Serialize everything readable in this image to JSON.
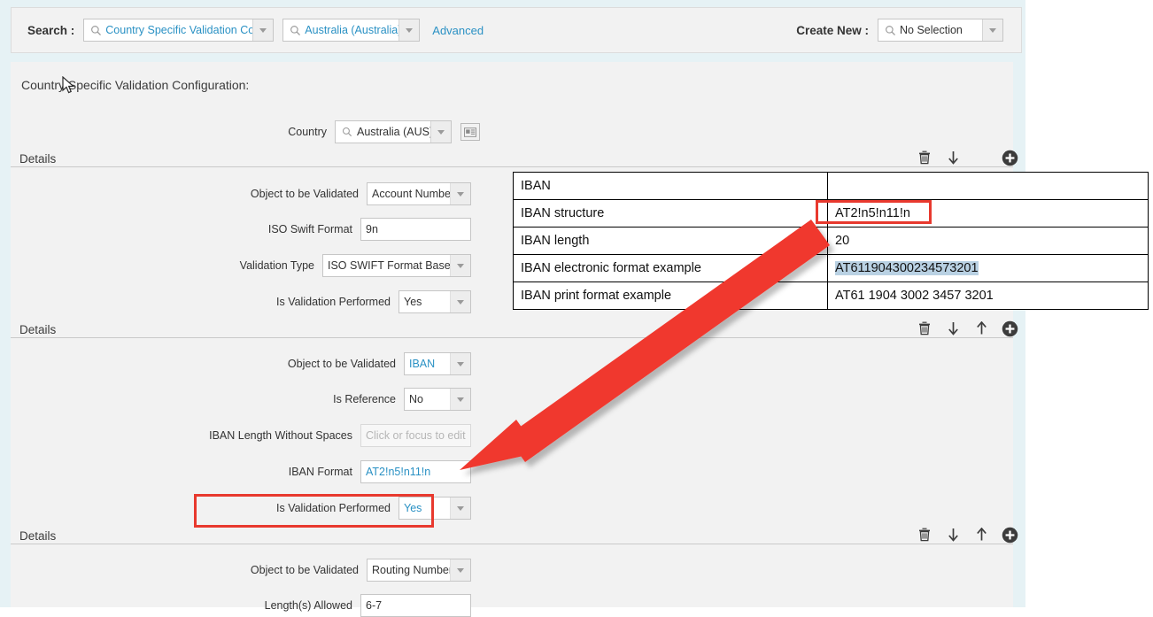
{
  "search_bar": {
    "search_label": "Search :",
    "object_lov": {
      "value": "Country Specific Validation Co...",
      "icon": "search-icon"
    },
    "country_lov": {
      "value": "Australia (Australia)",
      "icon": "search-icon"
    },
    "advanced_link": "Advanced",
    "create_new_label": "Create New :",
    "create_new_lov": {
      "value": "No Selection",
      "icon": "search-icon"
    }
  },
  "page": {
    "title": "Country Specific Validation Configuration:",
    "country_field": {
      "label": "Country",
      "value": "Australia (AUS)",
      "icon": "search-icon",
      "card_button_icon": "contact-card-icon"
    },
    "section_label": "Details"
  },
  "toolbar_icons": {
    "delete": "trash-icon",
    "move_down": "arrow-down-icon",
    "move_up": "arrow-up-icon",
    "add": "plus-circle-icon",
    "dropdown": "chevron-down-icon"
  },
  "details": [
    {
      "label": "Details",
      "toolbar": [
        "trash-icon",
        "arrow-down-icon",
        "plus-circle-icon"
      ],
      "fields": [
        {
          "label": "Object to be Validated",
          "type": "select",
          "value": "Account Number",
          "blue": false
        },
        {
          "label": "ISO Swift Format",
          "type": "text",
          "value": "9n",
          "blue": false
        },
        {
          "label": "Validation Type",
          "type": "select",
          "value": "ISO SWIFT Format Based",
          "blue": false
        },
        {
          "label": "Is Validation Performed",
          "type": "select",
          "value": "Yes",
          "blue": false
        }
      ]
    },
    {
      "label": "Details",
      "toolbar": [
        "trash-icon",
        "arrow-down-icon",
        "arrow-up-icon",
        "plus-circle-icon"
      ],
      "fields": [
        {
          "label": "Object to be Validated",
          "type": "select",
          "value": "IBAN",
          "blue": true
        },
        {
          "label": "Is Reference",
          "type": "select",
          "value": "No",
          "blue": false
        },
        {
          "label": "IBAN Length Without Spaces",
          "type": "text",
          "value": "",
          "placeholder": "Click or focus to edit",
          "blue": false
        },
        {
          "label": "IBAN Format",
          "type": "text",
          "value": "AT2!n5!n11!n",
          "blue": true
        },
        {
          "label": "Is Validation Performed",
          "type": "select",
          "value": "Yes",
          "blue": true,
          "highlighted": true
        }
      ]
    },
    {
      "label": "Details",
      "toolbar": [
        "trash-icon",
        "arrow-down-icon",
        "arrow-up-icon",
        "plus-circle-icon"
      ],
      "fields": [
        {
          "label": "Object to be Validated",
          "type": "select",
          "value": "Routing Number",
          "blue": false
        },
        {
          "label": "Length(s) Allowed",
          "type": "text",
          "value": "6-7",
          "blue": false
        }
      ]
    }
  ],
  "iban_reference_table": {
    "title_row": "IBAN",
    "rows": [
      {
        "name": "IBAN structure",
        "value": "AT2!n5!n11!n",
        "highlighted_box": true,
        "highlighted_text": false
      },
      {
        "name": "IBAN length",
        "value": "20",
        "highlighted_box": false,
        "highlighted_text": false
      },
      {
        "name": "IBAN electronic format example",
        "value": "AT611904300234573201",
        "highlighted_box": false,
        "highlighted_text": true
      },
      {
        "name": "IBAN print format example",
        "value": "AT61 1904 3002 3457 3201",
        "highlighted_box": false,
        "highlighted_text": false
      }
    ]
  },
  "annotations": {
    "accent_color": "#e8392e",
    "arrow": {
      "from": "IBAN structure cell",
      "to": "Is Validation Performed field"
    }
  }
}
